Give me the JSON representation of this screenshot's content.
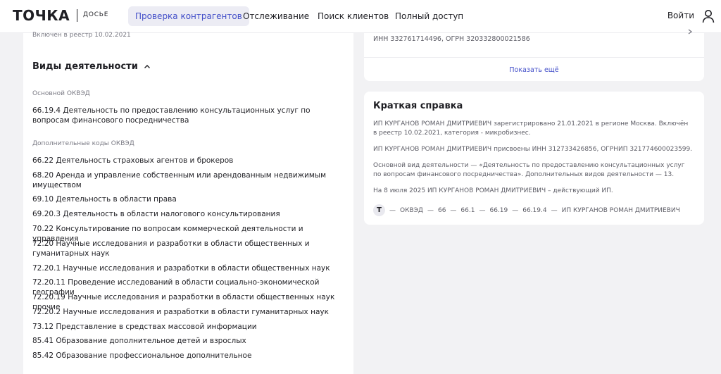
{
  "header": {
    "logo": "ТОЧКА",
    "logo_sub": "ДОСЬЕ",
    "nav": [
      {
        "label": "Проверка контрагентов",
        "active": true
      },
      {
        "label": "Отслеживание",
        "active": false
      },
      {
        "label": "Поиск клиентов",
        "active": false
      },
      {
        "label": "Полный доступ",
        "active": false
      }
    ],
    "login_label": "Войти",
    "user_icon": "user-icon",
    "accent_color": "#434fc9"
  },
  "left": {
    "registry_note": "Включен в реестр 10.02.2021",
    "section_title": "Виды деятельности",
    "main_label": "Основной ОКВЭД",
    "main_item": "66.19.4 Деятельность по предоставлению консультационных услуг по вопросам финансового посредничества",
    "additional_label": "Дополнительные коды ОКВЭД",
    "additional_items": [
      "66.22 Деятельность страховых агентов и брокеров",
      "68.20 Аренда и управление собственным или арендованным недвижимым имуществом",
      "69.10 Деятельность в области права",
      "69.20.3 Деятельность в области налогового консультирования",
      "70.22 Консультирование по вопросам коммерческой деятельности и управления",
      "72.20 Научные исследования и разработки в области общественных и гуманитарных наук",
      "72.20.1 Научные исследования и разработки в области общественных наук",
      "72.20.11 Проведение исследований в области социально-экономической географии",
      "72.20.19 Научные исследования и разработки в области общественных наук прочие",
      "72.20.2 Научные исследования и разработки в области гуманитарных наук",
      "73.12 Представление в средствах массовой информации",
      "85.41 Образование дополнительное детей и взрослых",
      "85.42 Образование профессиональное дополнительное"
    ]
  },
  "right": {
    "inn_line": "ИНН 332761714496, ОГРН 320332800021586",
    "show_more": "Показать ещё",
    "brief_title": "Краткая справка",
    "para1": "ИП КУРГАНОВ РОМАН ДМИТРИЕВИЧ зарегистрировано 21.01.2021 в регионе Москва. Включён в реестр 10.02.2021, категория - микробизнес.",
    "para2": "ИП КУРГАНОВ РОМАН ДМИТРИЕВИЧ присвоены ИНН 312733426856, ОГРНИП 321774600023599.",
    "para3": "Основной вид деятельности — «Деятельность по предоставлению консультационных услуг по вопросам финансового посредничества». Дополнительных видов деятельности — 13.",
    "para4": "На 8 июля 2025 ИП КУРГАНОВ РОМАН ДМИТРИЕВИЧ – действующий ИП.",
    "breadcrumb": {
      "badge": "Т",
      "items": [
        "ОКВЭД",
        "66",
        "66.1",
        "66.19",
        "66.19.4",
        "ИП КУРГАНОВ РОМАН ДМИТРИЕВИЧ"
      ],
      "separator": "—"
    }
  }
}
